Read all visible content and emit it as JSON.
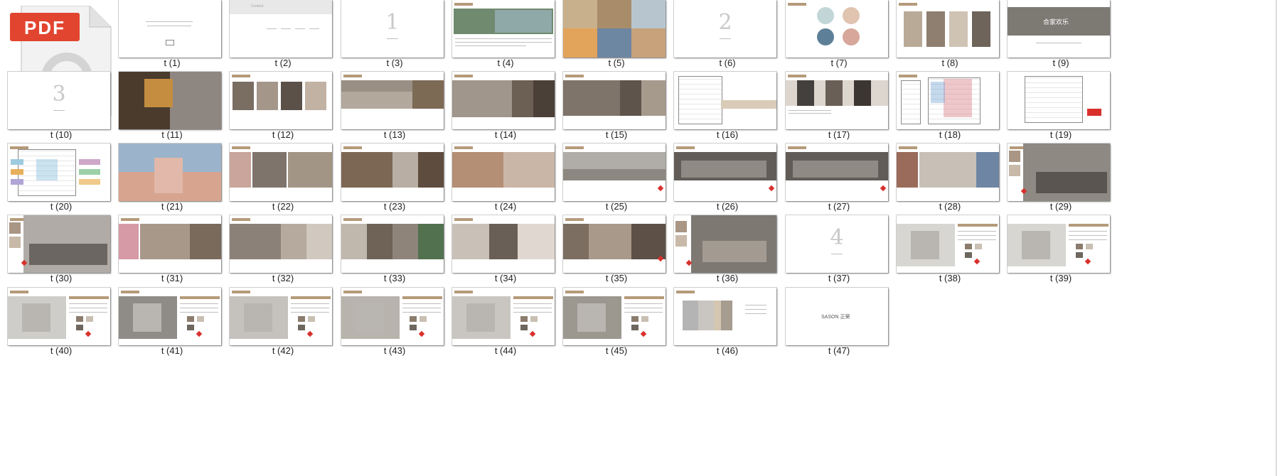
{
  "file": {
    "badge": "PDF",
    "name": "pdf"
  },
  "thumbs": [
    {
      "label": "t (1)"
    },
    {
      "label": "t (2)"
    },
    {
      "label": "t (3)"
    },
    {
      "label": "t (4)"
    },
    {
      "label": "t (5)"
    },
    {
      "label": "t (6)"
    },
    {
      "label": "t (7)"
    },
    {
      "label": "t (8)"
    },
    {
      "label": "t (9)"
    },
    {
      "label": "t (10)"
    },
    {
      "label": "t (11)"
    },
    {
      "label": "t (12)"
    },
    {
      "label": "t (13)"
    },
    {
      "label": "t (14)"
    },
    {
      "label": "t (15)"
    },
    {
      "label": "t (16)"
    },
    {
      "label": "t (17)"
    },
    {
      "label": "t (18)"
    },
    {
      "label": "t (19)"
    },
    {
      "label": "t (20)"
    },
    {
      "label": "t (21)"
    },
    {
      "label": "t (22)"
    },
    {
      "label": "t (23)"
    },
    {
      "label": "t (24)"
    },
    {
      "label": "t (25)"
    },
    {
      "label": "t (26)"
    },
    {
      "label": "t (27)"
    },
    {
      "label": "t (28)"
    },
    {
      "label": "t (29)"
    },
    {
      "label": "t (30)"
    },
    {
      "label": "t (31)"
    },
    {
      "label": "t (32)"
    },
    {
      "label": "t (33)"
    },
    {
      "label": "t (34)"
    },
    {
      "label": "t (35)"
    },
    {
      "label": "t (36)"
    },
    {
      "label": "t (37)"
    },
    {
      "label": "t (38)"
    },
    {
      "label": "t (39)"
    },
    {
      "label": "t (40)"
    },
    {
      "label": "t (41)"
    },
    {
      "label": "t (42)"
    },
    {
      "label": "t (43)"
    },
    {
      "label": "t (44)"
    },
    {
      "label": "t (45)"
    },
    {
      "label": "t (46)"
    },
    {
      "label": "t (47)"
    }
  ],
  "slide_text": {
    "t3_num": "1",
    "t6_num": "2",
    "t10_num": "3",
    "t37_num": "4",
    "t9_title": "合家欢乐",
    "t47_logo": "SASON 正荣"
  },
  "colors": {
    "accent": "#b59a7a",
    "pdf_red": "#e2452f",
    "page_bg": "#ffffff"
  }
}
